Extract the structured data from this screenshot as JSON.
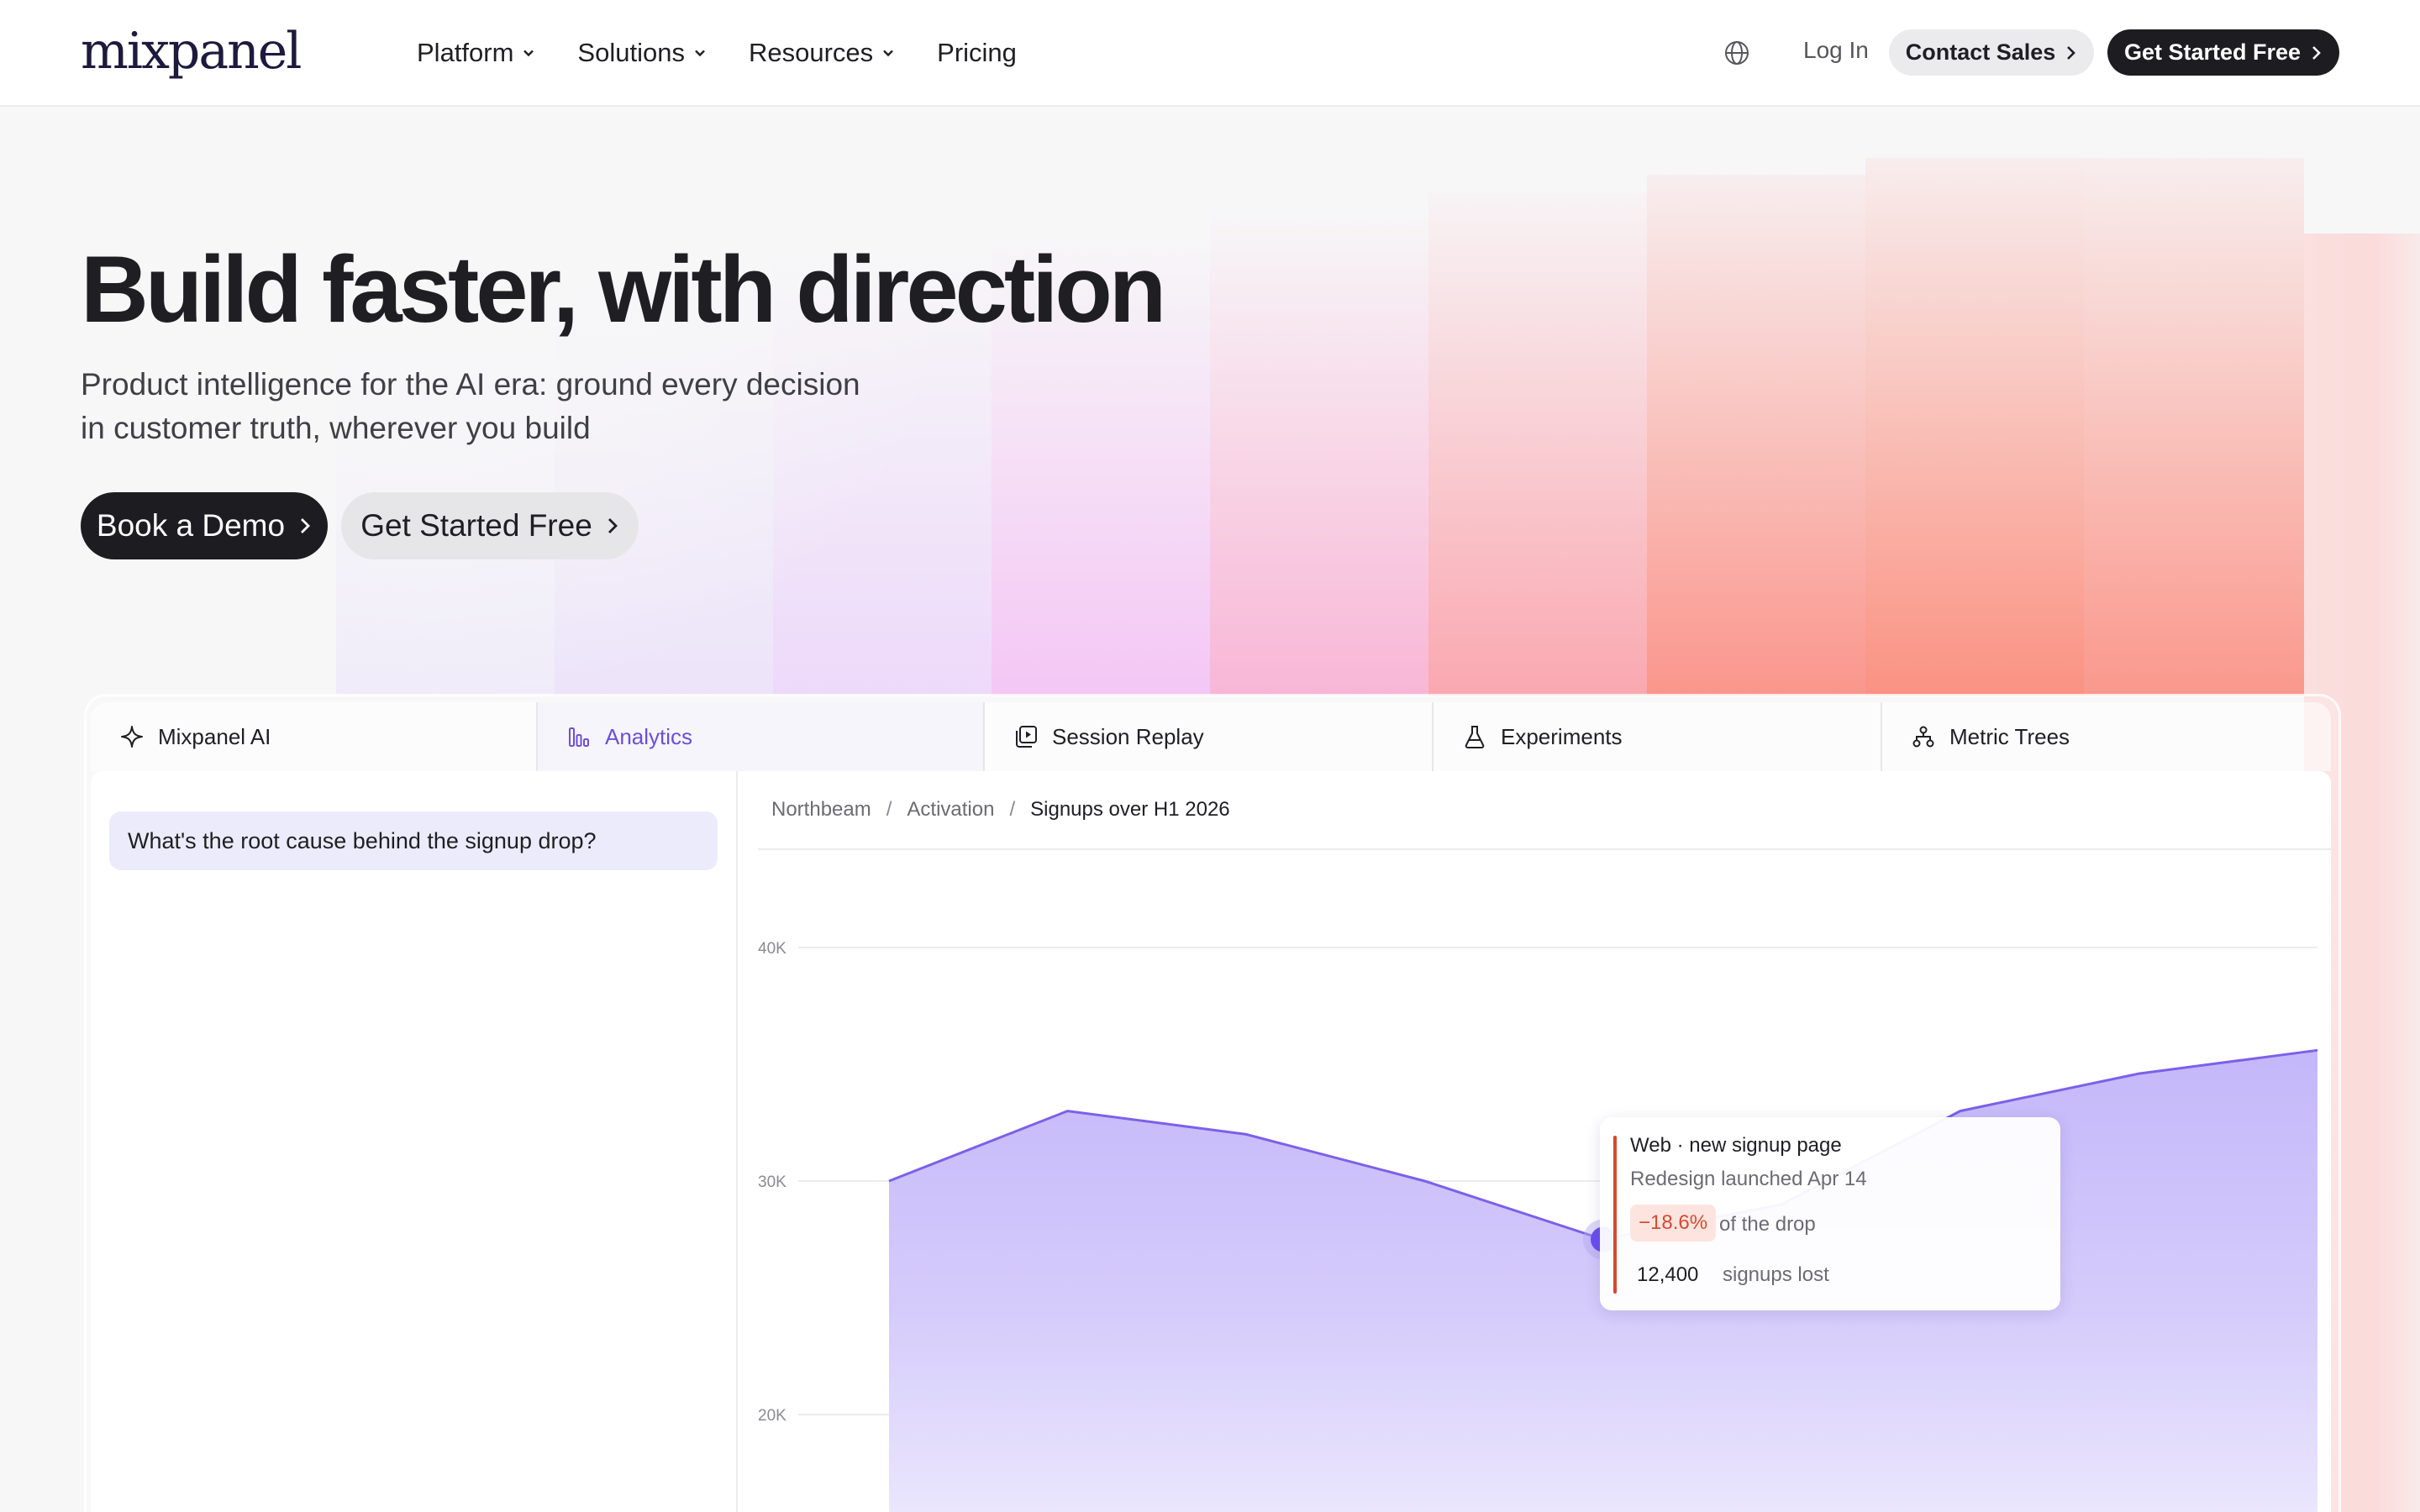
{
  "nav": {
    "logo": "mixpanel",
    "items": [
      {
        "label": "Platform",
        "has_menu": true
      },
      {
        "label": "Solutions",
        "has_menu": true
      },
      {
        "label": "Resources",
        "has_menu": true
      },
      {
        "label": "Pricing",
        "has_menu": false
      }
    ],
    "language_icon": "globe-icon",
    "login": "Log In",
    "contact_sales": "Contact Sales",
    "get_started": "Get Started Free"
  },
  "hero": {
    "title": "Build faster, with direction",
    "subtitle_line1": "Product intelligence for the AI era: ground every decision",
    "subtitle_line2": "in customer truth, wherever you build",
    "book_demo": "Book a Demo",
    "get_started": "Get Started Free"
  },
  "product_tabs": [
    {
      "label": "Mixpanel AI",
      "icon": "sparkle-icon",
      "active": false
    },
    {
      "label": "Analytics",
      "icon": "bar-chart-icon",
      "active": true
    },
    {
      "label": "Session Replay",
      "icon": "replay-icon",
      "active": false
    },
    {
      "label": "Experiments",
      "icon": "flask-icon",
      "active": false
    },
    {
      "label": "Metric Trees",
      "icon": "tree-icon",
      "active": false
    }
  ],
  "assistant": {
    "question": "What's the root cause behind the signup drop?"
  },
  "breadcrumb": {
    "items": [
      "Northbeam",
      "Activation",
      "Signups over H1 2026"
    ]
  },
  "tooltip": {
    "title": "Web · new signup page",
    "subtitle": "Redesign launched Apr 14",
    "drop_pct": "−18.6%",
    "drop_label": "of the drop",
    "lost_value": "12,400",
    "lost_label": "signups lost"
  },
  "colors": {
    "accent": "#6b4fd8",
    "series_line": "#7b61e8",
    "series_fill": "#c9bdfa",
    "highlight_point": "#6a4ff0",
    "negative": "#d44a32",
    "dark_button": "#1c1c21"
  },
  "chart_data": {
    "type": "area",
    "title": "",
    "xlabel": "",
    "ylabel": "",
    "yticks": [
      "40K",
      "30K",
      "20K"
    ],
    "ytick_values": [
      40000,
      30000,
      20000
    ],
    "ylim": [
      14000,
      44000
    ],
    "grid": true,
    "x": [
      0,
      1,
      2,
      3,
      4,
      5,
      6,
      7,
      8
    ],
    "values": [
      30000,
      33000,
      32000,
      30000,
      27500,
      29000,
      33000,
      34600,
      35600
    ],
    "highlight_index": 4
  }
}
